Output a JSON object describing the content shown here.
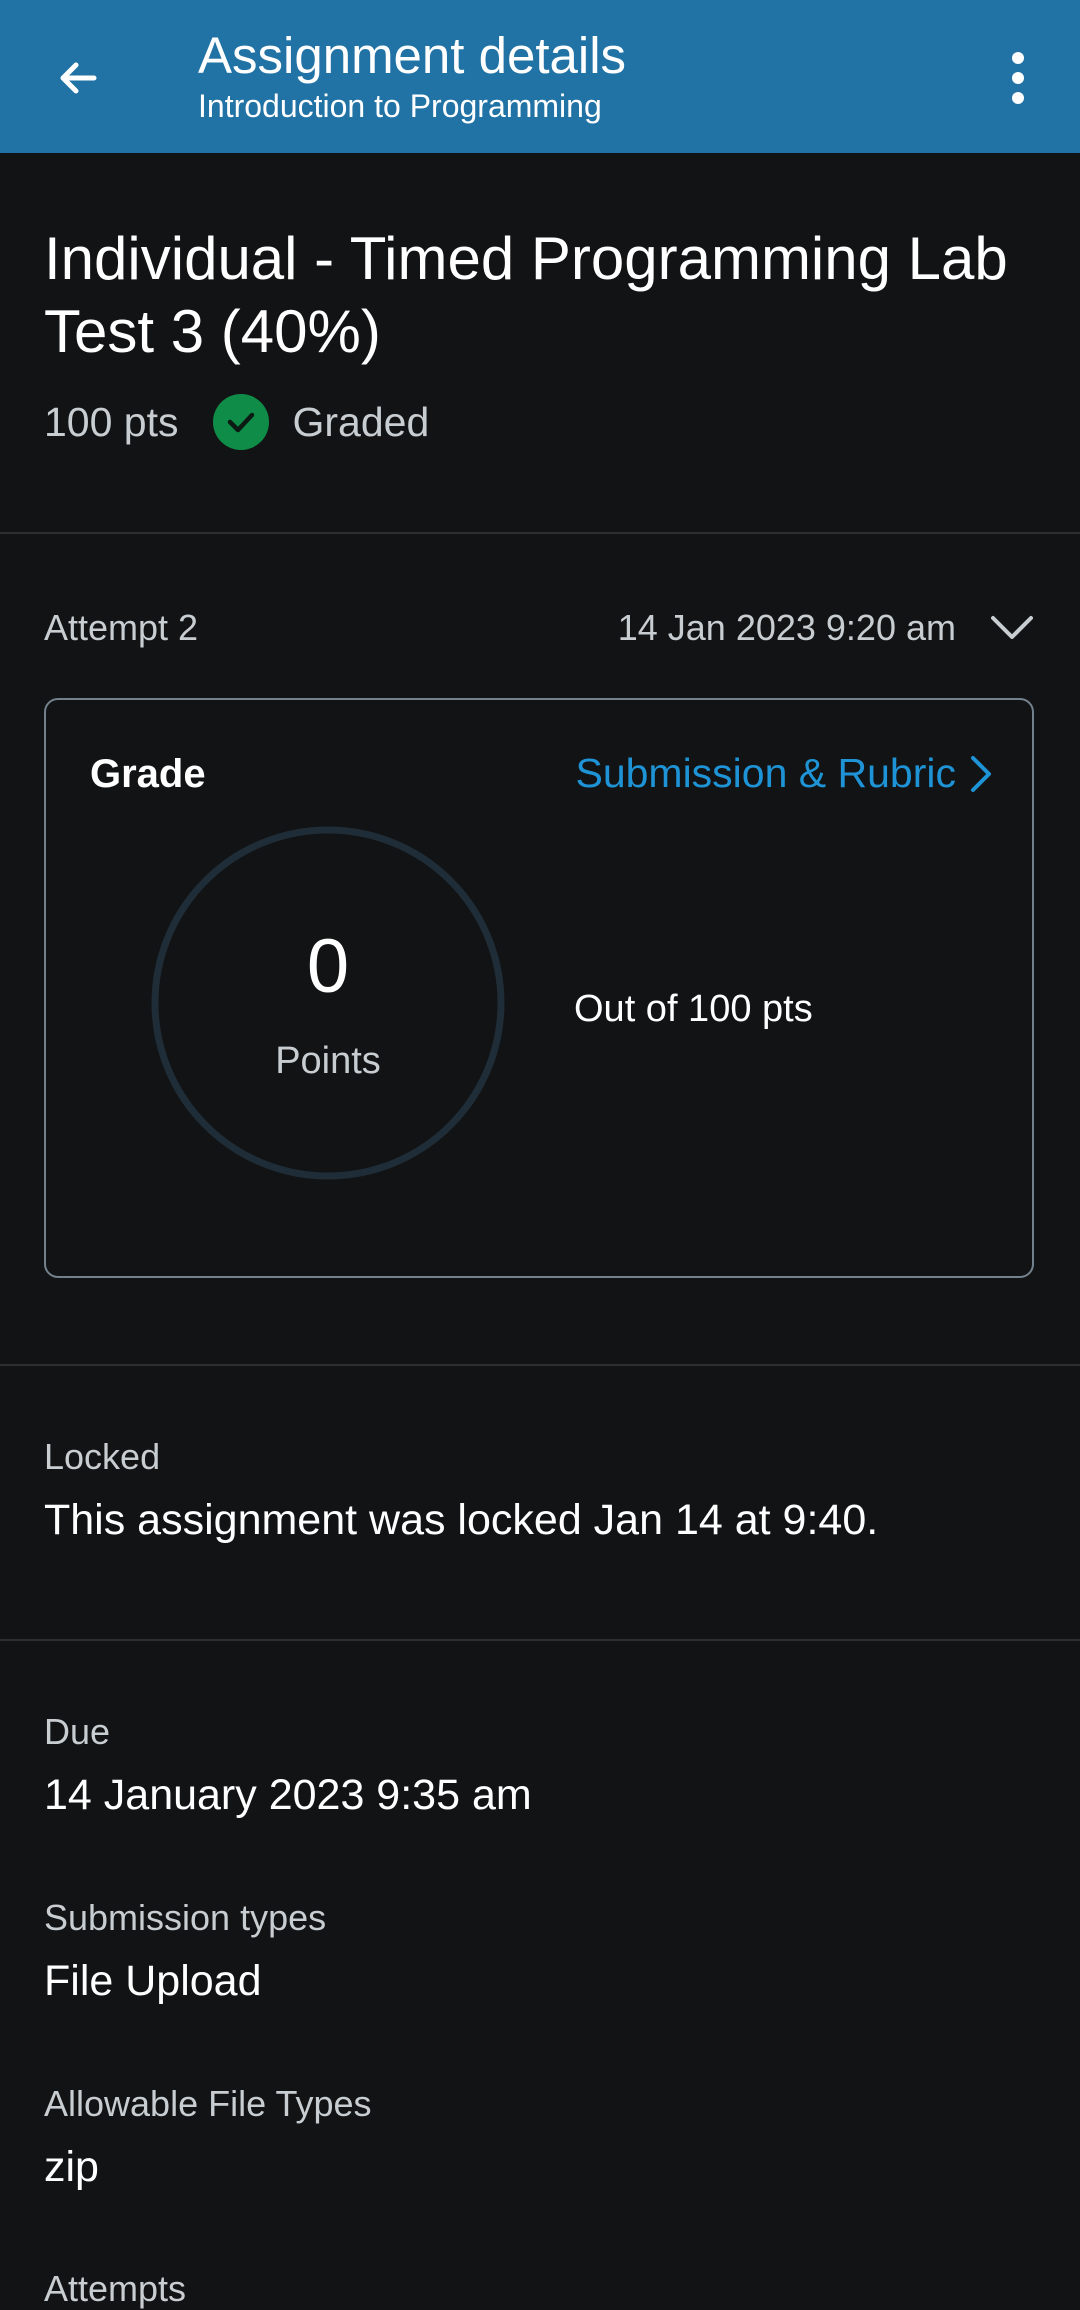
{
  "header": {
    "title": "Assignment details",
    "subtitle": "Introduction to Programming"
  },
  "assignment": {
    "title": "Individual - Timed Programming Lab Test 3 (40%)",
    "points": "100 pts",
    "status": "Graded"
  },
  "attempt": {
    "label": "Attempt 2",
    "date": "14 Jan 2023 9:20 am"
  },
  "grade": {
    "label": "Grade",
    "link": "Submission & Rubric",
    "score": "0",
    "score_label": "Points",
    "out_of": "Out of 100 pts",
    "score_fraction": 0
  },
  "locked": {
    "label": "Locked",
    "text": "This assignment was locked Jan 14 at 9:40."
  },
  "details": {
    "due_label": "Due",
    "due_value": "14 January 2023 9:35 am",
    "submission_types_label": "Submission types",
    "submission_types_value": "File Upload",
    "file_types_label": "Allowable File Types",
    "file_types_value": "zip",
    "attempts_label": "Attempts"
  },
  "colors": {
    "header_bg": "#2273a5",
    "link": "#1e93d6",
    "success": "#0f8d48",
    "background": "#121314"
  },
  "icons": {
    "back": "arrow-left-icon",
    "more": "more-vertical-icon",
    "graded": "check-circle-icon",
    "expand": "chevron-down-icon",
    "link": "chevron-right-icon"
  }
}
